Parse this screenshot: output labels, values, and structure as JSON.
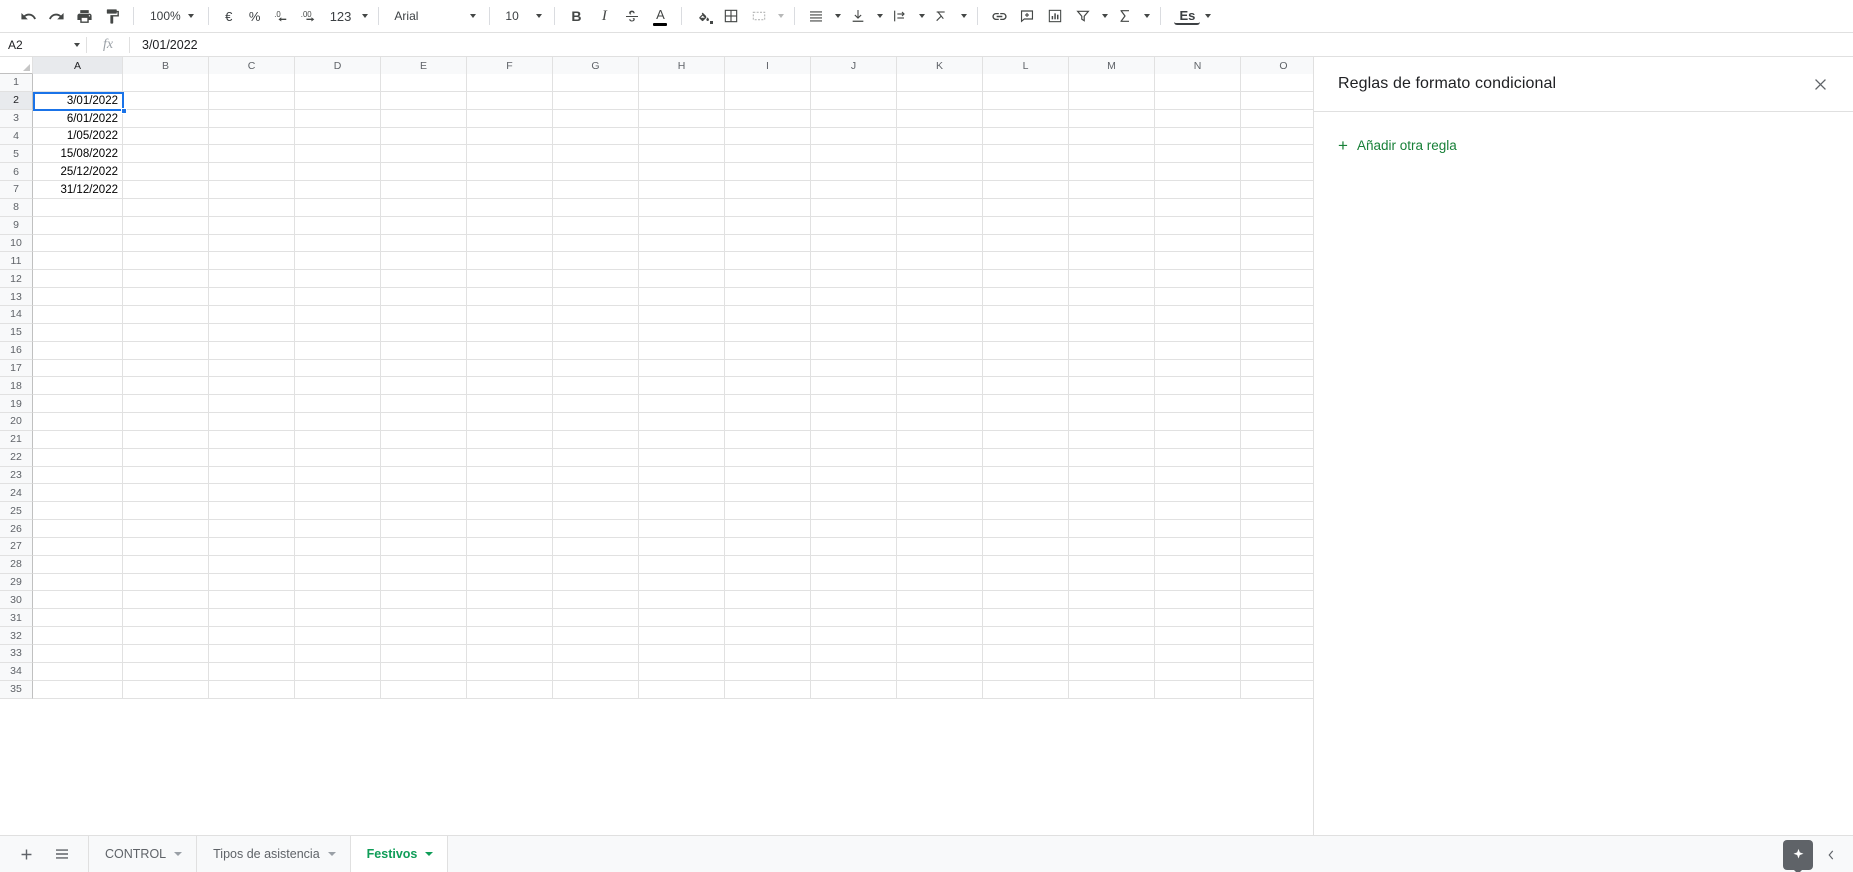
{
  "toolbar": {
    "undo_label": "undo",
    "redo_label": "redo",
    "print_label": "print",
    "paint_format_label": "paint-format",
    "zoom_value": "100%",
    "currency_label": "€",
    "percent_label": "%",
    "decrease_decimal_label": ".0",
    "increase_decimal_label": ".00",
    "more_formats_label": "123",
    "font_name": "Arial",
    "font_size": "10",
    "bold_label": "B",
    "italic_label": "I",
    "strikethrough_label": "S",
    "text_color_label": "A",
    "fill_color_label": "fill-color",
    "borders_label": "borders",
    "merge_label": "merge-cells",
    "halign_label": "horizontal-align",
    "valign_label": "vertical-align",
    "text_wrap_label": "text-wrapping",
    "text_rotation_label": "text-rotation",
    "link_label": "insert-link",
    "comment_label": "insert-comment",
    "chart_label": "insert-chart",
    "filter_label": "create-filter",
    "functions_label": "functions",
    "locale_label": "Es",
    "collapse_label": "collapse-toolbar"
  },
  "formula_bar": {
    "name_box": "A2",
    "fx_label": "fx",
    "value": "3/01/2022"
  },
  "grid": {
    "columns": [
      "A",
      "B",
      "C",
      "D",
      "E",
      "F",
      "G",
      "H",
      "I",
      "J",
      "K",
      "L",
      "M",
      "N",
      "O"
    ],
    "selected_column": "A",
    "selected_row": "2",
    "selected_cell": "A2",
    "rows": [
      {
        "n": "1",
        "a": ""
      },
      {
        "n": "2",
        "a": "3/01/2022"
      },
      {
        "n": "3",
        "a": "6/01/2022"
      },
      {
        "n": "4",
        "a": "1/05/2022"
      },
      {
        "n": "5",
        "a": "15/08/2022"
      },
      {
        "n": "6",
        "a": "25/12/2022"
      },
      {
        "n": "7",
        "a": "31/12/2022"
      },
      {
        "n": "8",
        "a": ""
      },
      {
        "n": "9",
        "a": ""
      },
      {
        "n": "10",
        "a": ""
      },
      {
        "n": "11",
        "a": ""
      },
      {
        "n": "12",
        "a": ""
      },
      {
        "n": "13",
        "a": ""
      },
      {
        "n": "14",
        "a": ""
      },
      {
        "n": "15",
        "a": ""
      },
      {
        "n": "16",
        "a": ""
      },
      {
        "n": "17",
        "a": ""
      },
      {
        "n": "18",
        "a": ""
      },
      {
        "n": "19",
        "a": ""
      },
      {
        "n": "20",
        "a": ""
      },
      {
        "n": "21",
        "a": ""
      },
      {
        "n": "22",
        "a": ""
      },
      {
        "n": "23",
        "a": ""
      },
      {
        "n": "24",
        "a": ""
      },
      {
        "n": "25",
        "a": ""
      },
      {
        "n": "26",
        "a": ""
      },
      {
        "n": "27",
        "a": ""
      },
      {
        "n": "28",
        "a": ""
      },
      {
        "n": "29",
        "a": ""
      },
      {
        "n": "30",
        "a": ""
      },
      {
        "n": "31",
        "a": ""
      },
      {
        "n": "32",
        "a": ""
      },
      {
        "n": "33",
        "a": ""
      },
      {
        "n": "34",
        "a": ""
      },
      {
        "n": "35",
        "a": ""
      }
    ]
  },
  "side_panel": {
    "title": "Reglas de formato condicional",
    "close_label": "close-panel",
    "add_rule_label": "Añadir otra regla",
    "plus_glyph": "+"
  },
  "bottom_bar": {
    "add_sheet_label": "add-sheet",
    "all_sheets_label": "all-sheets",
    "tabs": [
      {
        "label": "CONTROL",
        "active": false
      },
      {
        "label": "Tipos de asistencia",
        "active": false
      },
      {
        "label": "Festivos",
        "active": true
      }
    ],
    "explore_label": "explore",
    "expand_label": "expand-sidebar"
  },
  "colors": {
    "accent_blue": "#1a73e8",
    "active_tab_green": "#0f9d58",
    "link_green": "#188038",
    "header_gray": "#f8f9fa",
    "grid_line": "#e1e1e1"
  }
}
